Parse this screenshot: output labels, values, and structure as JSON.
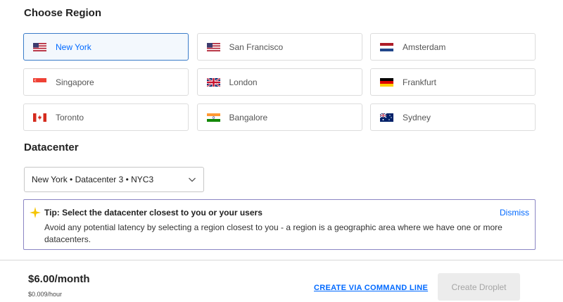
{
  "region_section": {
    "title": "Choose Region",
    "regions": [
      {
        "label": "New York",
        "flag": "us-flag-icon",
        "selected": true
      },
      {
        "label": "San Francisco",
        "flag": "us-flag-icon",
        "selected": false
      },
      {
        "label": "Amsterdam",
        "flag": "nl-flag-icon",
        "selected": false
      },
      {
        "label": "Singapore",
        "flag": "sg-flag-icon",
        "selected": false
      },
      {
        "label": "London",
        "flag": "uk-flag-icon",
        "selected": false
      },
      {
        "label": "Frankfurt",
        "flag": "de-flag-icon",
        "selected": false
      },
      {
        "label": "Toronto",
        "flag": "ca-flag-icon",
        "selected": false
      },
      {
        "label": "Bangalore",
        "flag": "in-flag-icon",
        "selected": false
      },
      {
        "label": "Sydney",
        "flag": "au-flag-icon",
        "selected": false
      }
    ]
  },
  "datacenter_section": {
    "title": "Datacenter",
    "selected_value": "New York • Datacenter 3 • NYC3"
  },
  "tip": {
    "icon": "sparkle-icon",
    "title": "Tip: Select the datacenter closest to you or your users",
    "body": "Avoid any potential latency by selecting a region closest to you - a region is a geographic area where we have one or more datacenters.",
    "dismiss_label": "Dismiss"
  },
  "footer": {
    "price": "$6.00/month",
    "hourly": "$0.009/hour",
    "cli_link": "CREATE VIA COMMAND LINE",
    "create_button": "Create Droplet"
  },
  "colors": {
    "accent": "#0069ff",
    "selected_border": "#3b7cc9",
    "tip_border": "#8b86c4",
    "tip_icon": "#f5c400",
    "disabled_button_bg": "#ececec"
  }
}
